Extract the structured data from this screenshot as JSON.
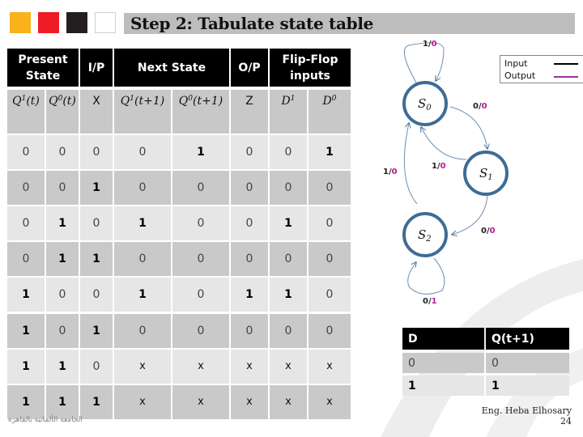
{
  "slide": {
    "title": "Step 2: Tabulate state table",
    "swatch_colors": [
      "#f9b21b",
      "#ee1c25",
      "#231f20",
      "#ffffff"
    ],
    "author": "Eng. Heba Elhosary",
    "page_number": "24",
    "footer_arabic": "الجامعة الألمانية بالقاهرة"
  },
  "state_table": {
    "group_headers": [
      {
        "label": "Present State"
      },
      {
        "label": "I/P"
      },
      {
        "label": "Next State"
      },
      {
        "label": "O/P"
      },
      {
        "label": "Flip-Flop inputs"
      }
    ],
    "columns": [
      {
        "label": "Q",
        "sub": "1",
        "suffix": "(t)"
      },
      {
        "label": "Q",
        "sub": "0",
        "suffix": "(t)"
      },
      {
        "label": "X"
      },
      {
        "label": "Q",
        "sub": "1",
        "suffix": "(t+1)"
      },
      {
        "label": "Q",
        "sub": "0",
        "suffix": "(t+1)"
      },
      {
        "label": "Z"
      },
      {
        "label": "D",
        "sub": "1"
      },
      {
        "label": "D",
        "sub": "0"
      }
    ],
    "rows": [
      [
        "0",
        "0",
        "0",
        "0",
        "1",
        "0",
        "0",
        "1"
      ],
      [
        "0",
        "0",
        "1",
        "0",
        "0",
        "0",
        "0",
        "0"
      ],
      [
        "0",
        "1",
        "0",
        "1",
        "0",
        "0",
        "1",
        "0"
      ],
      [
        "0",
        "1",
        "1",
        "0",
        "0",
        "0",
        "0",
        "0"
      ],
      [
        "1",
        "0",
        "0",
        "1",
        "0",
        "1",
        "1",
        "0"
      ],
      [
        "1",
        "0",
        "1",
        "0",
        "0",
        "0",
        "0",
        "0"
      ],
      [
        "1",
        "1",
        "0",
        "x",
        "x",
        "x",
        "x",
        "x"
      ],
      [
        "1",
        "1",
        "1",
        "x",
        "x",
        "x",
        "x",
        "x"
      ]
    ]
  },
  "state_diagram": {
    "states": [
      {
        "id": "S0",
        "label": "S",
        "sub": "0"
      },
      {
        "id": "S1",
        "label": "S",
        "sub": "1"
      },
      {
        "id": "S2",
        "label": "S",
        "sub": "2"
      }
    ],
    "transitions": [
      {
        "from": "S0",
        "to": "S0",
        "input": "1",
        "output": "0"
      },
      {
        "from": "S0",
        "to": "S1",
        "input": "0",
        "output": "0"
      },
      {
        "from": "S1",
        "to": "S0",
        "input": "1",
        "output": "0"
      },
      {
        "from": "S2",
        "to": "S0",
        "input": "1",
        "output": "0"
      },
      {
        "from": "S1",
        "to": "S2",
        "input": "0",
        "output": "0"
      },
      {
        "from": "S2",
        "to": "S2",
        "input": "0",
        "output": "1"
      }
    ],
    "legend": {
      "input_label": "Input",
      "output_label": "Output",
      "input_color": "#000000",
      "output_color": "#a0309a"
    },
    "colors": {
      "state_stroke": "#3f6c96",
      "output_text": "#c0139e"
    }
  },
  "dff_table": {
    "headers": [
      "D",
      "Q(t+1)"
    ],
    "rows": [
      [
        "0",
        "0"
      ],
      [
        "1",
        "1"
      ]
    ]
  }
}
